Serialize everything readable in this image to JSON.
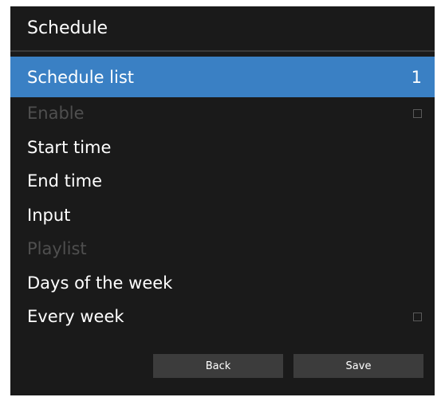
{
  "header": {
    "title": "Schedule"
  },
  "menu": {
    "items": [
      {
        "label": "Schedule list",
        "value": "1"
      },
      {
        "label": "Enable",
        "checkbox": false
      },
      {
        "label": "Start time"
      },
      {
        "label": "End time"
      },
      {
        "label": "Input"
      },
      {
        "label": "Playlist"
      },
      {
        "label": "Days of the week"
      },
      {
        "label": "Every week",
        "checkbox": false
      }
    ]
  },
  "footer": {
    "back_label": "Back",
    "save_label": "Save"
  },
  "colors": {
    "selected_background": "#3a80c4",
    "panel_background": "#1a1a1a",
    "disabled_text": "#4f4f4f"
  }
}
